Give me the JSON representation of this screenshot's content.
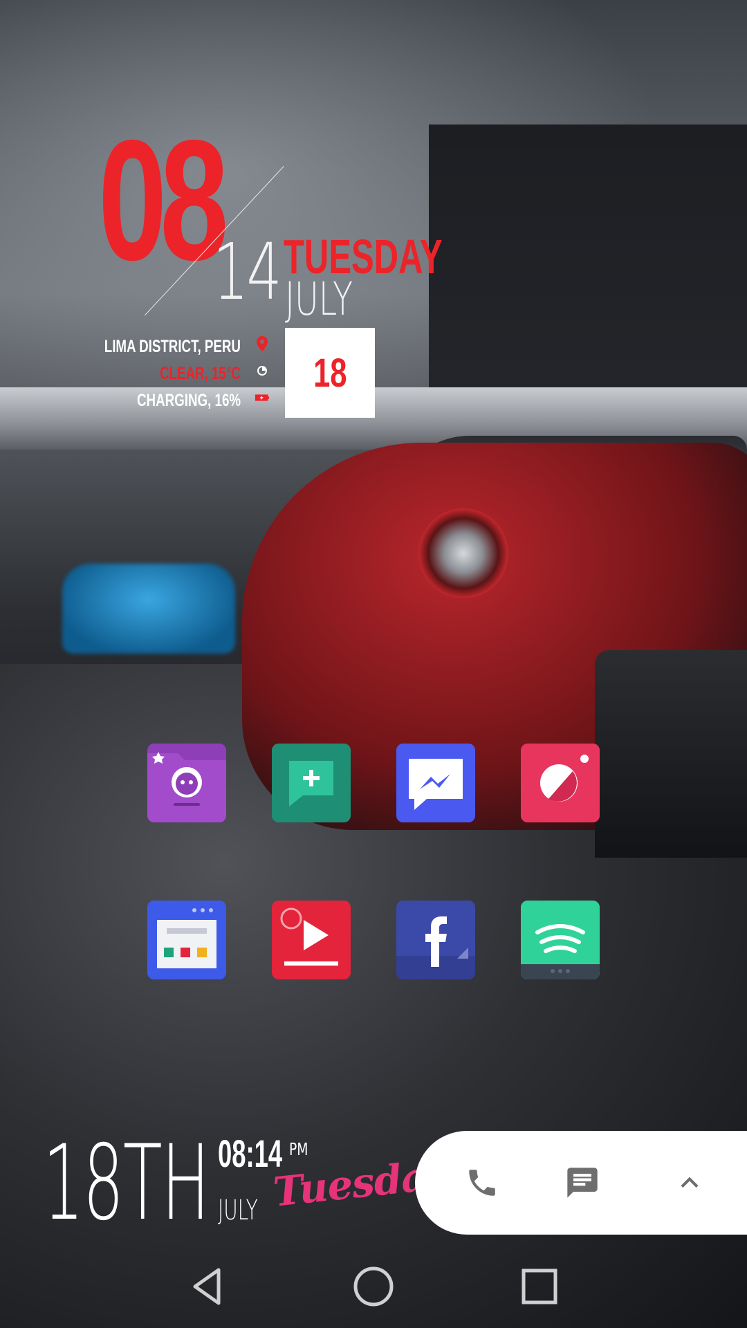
{
  "clock_widget": {
    "hour": "08",
    "minutes": "14",
    "weekday": "TUESDAY",
    "month": "JULY",
    "day": "18",
    "location": "LIMA DISTRICT, PERU",
    "weather": "CLEAR, 15°C",
    "battery": "CHARGING, 16%",
    "icons": [
      "location-pin-icon",
      "weather-moon-icon",
      "battery-charging-icon"
    ],
    "accent_color": "#ec2329"
  },
  "apps": [
    {
      "name": "file-manager",
      "icon": "folder-face-icon",
      "color": "#8e3fb8"
    },
    {
      "name": "messaging-plus",
      "icon": "chat-plus-icon",
      "color": "#1e8e74"
    },
    {
      "name": "messenger",
      "icon": "messenger-bolt-icon",
      "color": "#4a5af0"
    },
    {
      "name": "camera-lens",
      "icon": "lens-icon",
      "color": "#e8355e"
    },
    {
      "name": "browser-launcher",
      "icon": "window-icon",
      "color": "#3d5ae8"
    },
    {
      "name": "video-player",
      "icon": "play-icon",
      "color": "#e3243b"
    },
    {
      "name": "facebook",
      "icon": "facebook-f-icon",
      "color": "#3b4aa8"
    },
    {
      "name": "spotify",
      "icon": "spotify-waves-icon",
      "color": "#2fd39a"
    }
  ],
  "bottom_widget": {
    "day_ordinal": "18TH",
    "time": "08:14",
    "ampm": "PM",
    "month": "JULY",
    "weekday_script": "Tuesday",
    "script_color": "#e6337a"
  },
  "dock": {
    "icons": [
      "phone-icon",
      "message-icon",
      "chevron-up-icon"
    ]
  },
  "navbar": {
    "icons": [
      "back-icon",
      "home-icon",
      "recents-icon"
    ]
  }
}
